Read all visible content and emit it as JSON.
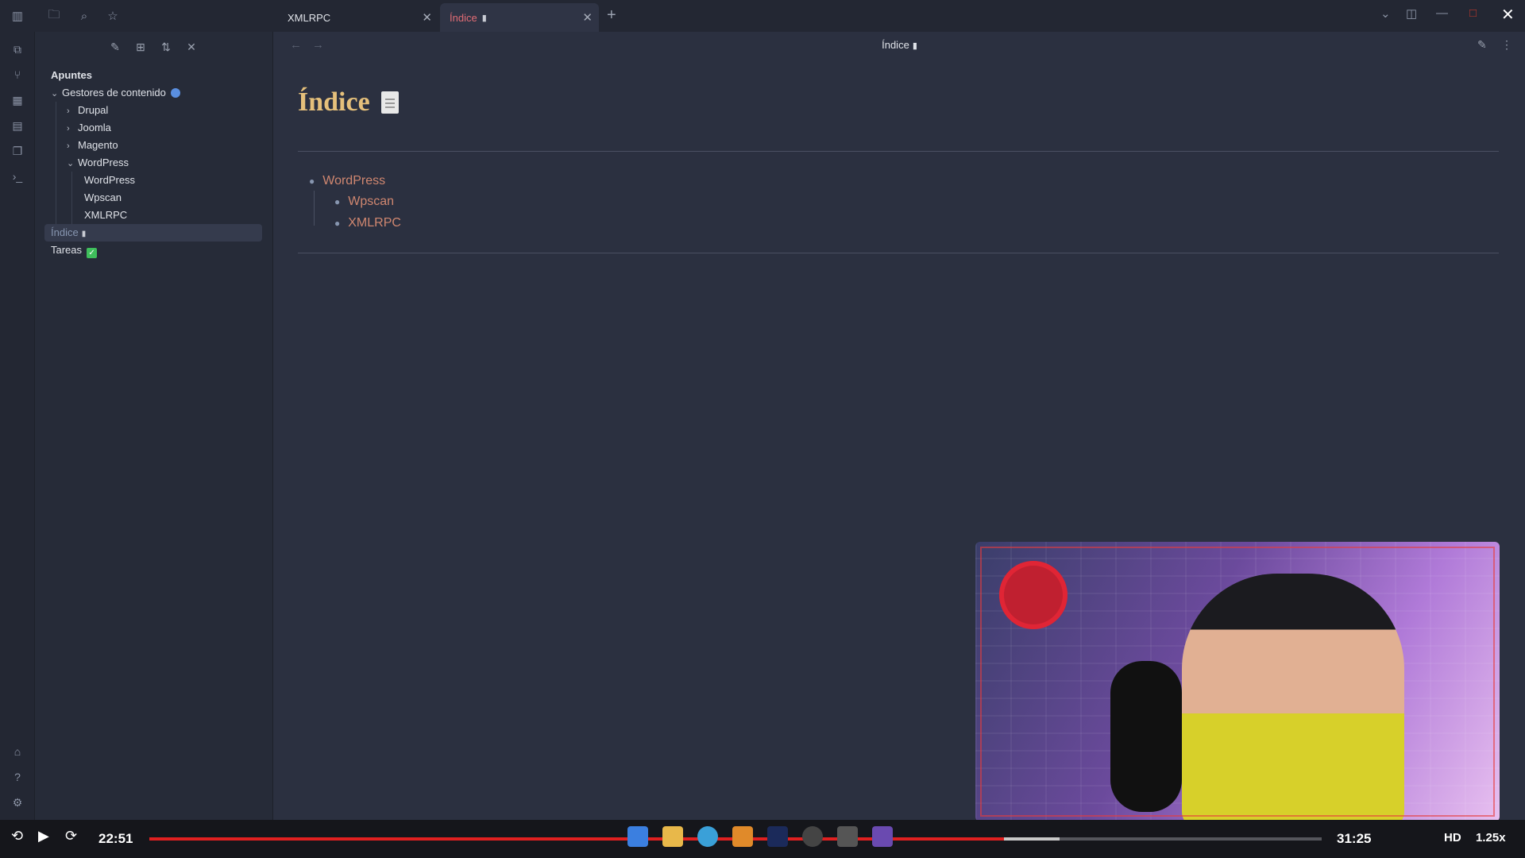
{
  "tabs": [
    {
      "label": "XMLRPC"
    },
    {
      "label": "Índice"
    }
  ],
  "sidebar": {
    "root": "Apuntes",
    "items": [
      {
        "label": "Gestores de contenido"
      },
      {
        "label": "Drupal"
      },
      {
        "label": "Joomla"
      },
      {
        "label": "Magento"
      },
      {
        "label": "WordPress"
      },
      {
        "label": "WordPress"
      },
      {
        "label": "Wpscan"
      },
      {
        "label": "XMLRPC"
      },
      {
        "label": "Índice"
      },
      {
        "label": "Tareas"
      }
    ]
  },
  "content": {
    "view_title": "Índice",
    "heading": "Índice",
    "list": [
      {
        "label": "WordPress"
      },
      {
        "label": "Wpscan"
      },
      {
        "label": "XMLRPC"
      }
    ]
  },
  "player": {
    "current_time": "22:51",
    "end_time": "31:25",
    "quality": "HD",
    "speed": "1.25x",
    "progress": 0.73
  },
  "colors": {
    "accent": "#e5c07b",
    "link": "#d08770",
    "progress": "#e02020"
  }
}
